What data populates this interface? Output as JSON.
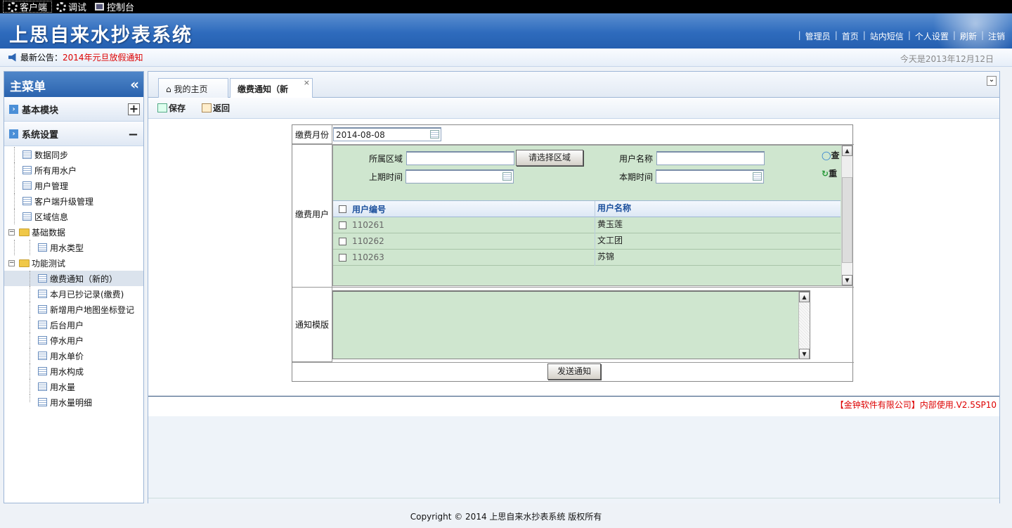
{
  "topbar": {
    "items": [
      "客户端",
      "调试",
      "控制台"
    ]
  },
  "header": {
    "title": "上思自来水抄表系统",
    "links": [
      "管理员",
      "首页",
      "站内短信",
      "个人设置",
      "刷新",
      "注销"
    ]
  },
  "notice": {
    "label": "最新公告：",
    "message": "2014年元旦放假通知",
    "date": "今天是2013年12月12日"
  },
  "sidebar": {
    "title": "主菜单",
    "collapse_glyph": "«",
    "modules": [
      {
        "label": "基本模块",
        "toggle": "+"
      },
      {
        "label": "系统设置",
        "toggle": "−"
      }
    ],
    "tree": [
      {
        "label": "数据同步"
      },
      {
        "label": "所有用水户"
      },
      {
        "label": "用户管理"
      },
      {
        "label": "客户端升级管理"
      },
      {
        "label": "区域信息"
      },
      {
        "label": "基础数据"
      },
      {
        "label": "用水类型"
      },
      {
        "label": "功能测试"
      },
      {
        "label": "缴费通知（新的）"
      },
      {
        "label": "本月已抄记录(缴费)"
      },
      {
        "label": "新增用户地图坐标登记"
      },
      {
        "label": "后台用户"
      },
      {
        "label": "停水用户"
      },
      {
        "label": "用水单价"
      },
      {
        "label": "用水构成"
      },
      {
        "label": "用水量"
      },
      {
        "label": "用水量明细"
      }
    ]
  },
  "tabs": [
    {
      "label": "我的主页"
    },
    {
      "label": "缴费通知（新"
    }
  ],
  "tab_close": "×",
  "toolbar": {
    "save": "保存",
    "back": "返回"
  },
  "form": {
    "month_label": "缴费月份",
    "month_value": "2014-08-08",
    "user_label": "缴费用户",
    "area_label": "所属区域",
    "area_value": "",
    "choose_area_button": "请选择区域",
    "username_label": "用户名称",
    "username_value": "",
    "last_time_label": "上期时间",
    "this_time_label": "本期时间",
    "search_button": "查",
    "reset_button": "重",
    "grid": {
      "columns": [
        "用户编号",
        "用户名称"
      ],
      "rows": [
        {
          "id": "110261",
          "name": "黄玉莲"
        },
        {
          "id": "110262",
          "name": "文工团"
        },
        {
          "id": "110263",
          "name": "苏锦"
        }
      ]
    },
    "template_label": "通知模版",
    "template_value": "",
    "send_button": "发送通知"
  },
  "version": "【金钟软件有限公司】内部使用.V2.5SP10",
  "copyright": "Copyright © 2014 上思自来水抄表系统  版权所有"
}
